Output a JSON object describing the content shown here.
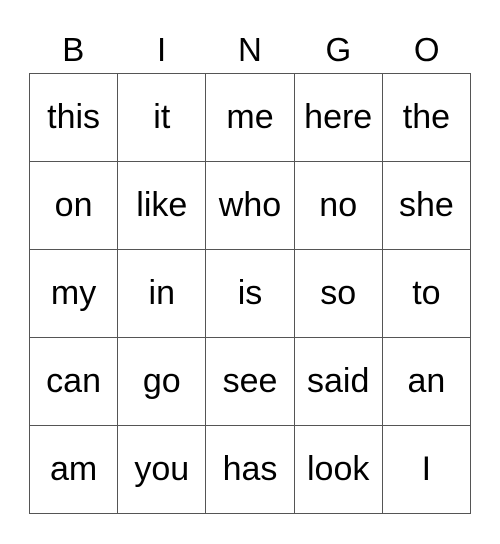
{
  "header": [
    "B",
    "I",
    "N",
    "G",
    "O"
  ],
  "rows": [
    [
      "this",
      "it",
      "me",
      "here",
      "the"
    ],
    [
      "on",
      "like",
      "who",
      "no",
      "she"
    ],
    [
      "my",
      "in",
      "is",
      "so",
      "to"
    ],
    [
      "can",
      "go",
      "see",
      "said",
      "an"
    ],
    [
      "am",
      "you",
      "has",
      "look",
      "I"
    ]
  ]
}
